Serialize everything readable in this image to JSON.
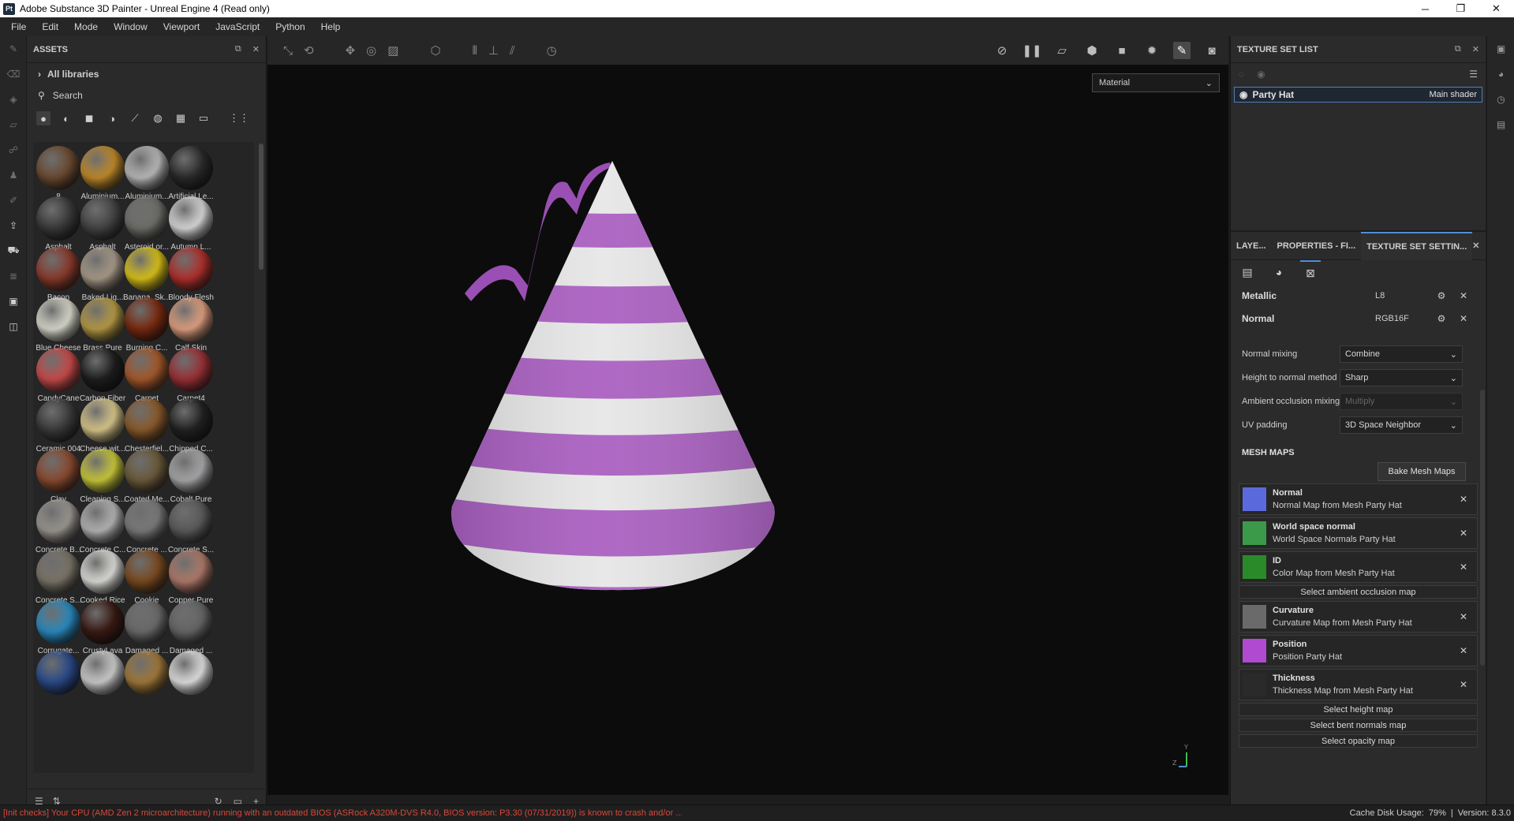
{
  "window": {
    "title": "Adobe Substance 3D Painter - Unreal Engine 4 (Read only)",
    "app_icon": "Pt",
    "minimize": "─",
    "maximize": "❐",
    "close": "✕"
  },
  "menu": [
    "File",
    "Edit",
    "Mode",
    "Window",
    "Viewport",
    "JavaScript",
    "Python",
    "Help"
  ],
  "assets": {
    "title": "ASSETS",
    "libraries": "All libraries",
    "search_placeholder": "Search",
    "items": [
      {
        "label": "8",
        "color": "#6b4a30"
      },
      {
        "label": "Aluminium...",
        "color": "#c08a2a"
      },
      {
        "label": "Aluminium...",
        "color": "#b9b9b9"
      },
      {
        "label": "Artificial Le...",
        "color": "#2a2a2a"
      },
      {
        "label": "Asphalt",
        "color": "#3a3a3a"
      },
      {
        "label": "Asphalt",
        "color": "#444444"
      },
      {
        "label": "Asteroid or...",
        "color": "#6e6e6a"
      },
      {
        "label": "Autumn L...",
        "color": "#d8d8d8"
      },
      {
        "label": "Bacon",
        "color": "#8a3a2c"
      },
      {
        "label": "Baked Lig...",
        "color": "#a89a88"
      },
      {
        "label": "Banana_Sk...",
        "color": "#d9c21a"
      },
      {
        "label": "Bloody Flesh",
        "color": "#b0302c"
      },
      {
        "label": "Blue Cheese",
        "color": "#d8d8cc"
      },
      {
        "label": "Brass Pure",
        "color": "#b69a44"
      },
      {
        "label": "Burning C...",
        "color": "#7a2a10"
      },
      {
        "label": "Calf Skin",
        "color": "#e0a080"
      },
      {
        "label": "CandyCane",
        "color": "#c84a4a"
      },
      {
        "label": "Carbon Fiber",
        "color": "#1e1e1e"
      },
      {
        "label": "Carpet",
        "color": "#a4582a"
      },
      {
        "label": "Carpet4",
        "color": "#9a3036"
      },
      {
        "label": "Ceramic 004",
        "color": "#3a3a3a"
      },
      {
        "label": "Cheese wit...",
        "color": "#d8c68a"
      },
      {
        "label": "Chesterfiel...",
        "color": "#8a5a2a"
      },
      {
        "label": "Chipped C...",
        "color": "#222222"
      },
      {
        "label": "Clay",
        "color": "#8a4a30"
      },
      {
        "label": "Cleaning S...",
        "color": "#c8c83a"
      },
      {
        "label": "Coated Me...",
        "color": "#6a5a3a"
      },
      {
        "label": "Cobalt Pure",
        "color": "#a8a8aa"
      },
      {
        "label": "Concrete B...",
        "color": "#9a9690"
      },
      {
        "label": "Concrete C...",
        "color": "#b4b4b4"
      },
      {
        "label": "Concrete ...",
        "color": "#7a7a7a"
      },
      {
        "label": "Concrete S...",
        "color": "#5a5a5a"
      },
      {
        "label": "Concrete S...",
        "color": "#7a7468"
      },
      {
        "label": "Cooked Rice",
        "color": "#dcdcd8"
      },
      {
        "label": "Cookie",
        "color": "#7a4a20"
      },
      {
        "label": "Copper Pure",
        "color": "#b07a6a"
      },
      {
        "label": "Corrugate...",
        "color": "#2a8ac0"
      },
      {
        "label": "CrustyLava",
        "color": "#3a1a14"
      },
      {
        "label": "Damaged ...",
        "color": "#6a6a6a"
      },
      {
        "label": "Damaged ...",
        "color": "#666666"
      },
      {
        "label": "",
        "color": "#2a4a8a"
      },
      {
        "label": "",
        "color": "#cccccc"
      },
      {
        "label": "",
        "color": "#a0783a"
      },
      {
        "label": "",
        "color": "#e0e0e0"
      }
    ]
  },
  "viewport": {
    "mode": "Material",
    "axis_y": "Y",
    "axis_z": "Z"
  },
  "texture_set_list": {
    "title": "TEXTURE SET LIST",
    "item": "Party Hat",
    "shader": "Main shader"
  },
  "settings": {
    "tabs": [
      "LAYE...",
      "PROPERTIES - FI...",
      "TEXTURE SET SETTIN..."
    ],
    "channels": [
      {
        "name": "Metallic",
        "format": "L8"
      },
      {
        "name": "Normal",
        "format": "RGB16F"
      }
    ],
    "props": [
      {
        "label": "Normal mixing",
        "value": "Combine",
        "disabled": false
      },
      {
        "label": "Height to normal method",
        "value": "Sharp",
        "disabled": false
      },
      {
        "label": "Ambient occlusion mixing",
        "value": "Multiply",
        "disabled": true
      },
      {
        "label": "UV padding",
        "value": "3D Space Neighbor",
        "disabled": false
      }
    ],
    "mesh_maps_title": "MESH MAPS",
    "bake_label": "Bake Mesh Maps",
    "maps": [
      {
        "name": "Normal",
        "src": "Normal Map from Mesh Party Hat"
      },
      {
        "name": "World space normal",
        "src": "World Space Normals Party Hat"
      },
      {
        "name": "ID",
        "src": "Color Map from Mesh Party Hat"
      },
      {
        "select": "Select ambient occlusion map"
      },
      {
        "name": "Curvature",
        "src": "Curvature Map from Mesh Party Hat"
      },
      {
        "name": "Position",
        "src": "Position Party Hat"
      },
      {
        "name": "Thickness",
        "src": "Thickness Map from Mesh Party Hat"
      }
    ],
    "select_buttons": [
      "Select height map",
      "Select bent normals map",
      "Select opacity map"
    ]
  },
  "status": {
    "warning": "[Init checks] Your CPU (AMD Zen 2 microarchitecture) running with an outdated BIOS (ASRock A320M-DVS R4.0, BIOS version: P3.30 (07/31/2019)) is known to crash and/or ...",
    "cache": "Cache Disk Usage:",
    "cache_value": "79%",
    "version": "Version: 8.3.0"
  },
  "colors": {
    "accent": "#4f8fd6",
    "hat_purple": "#a85cc0",
    "hat_white": "#e6e6e6",
    "warning": "#d9473a"
  }
}
